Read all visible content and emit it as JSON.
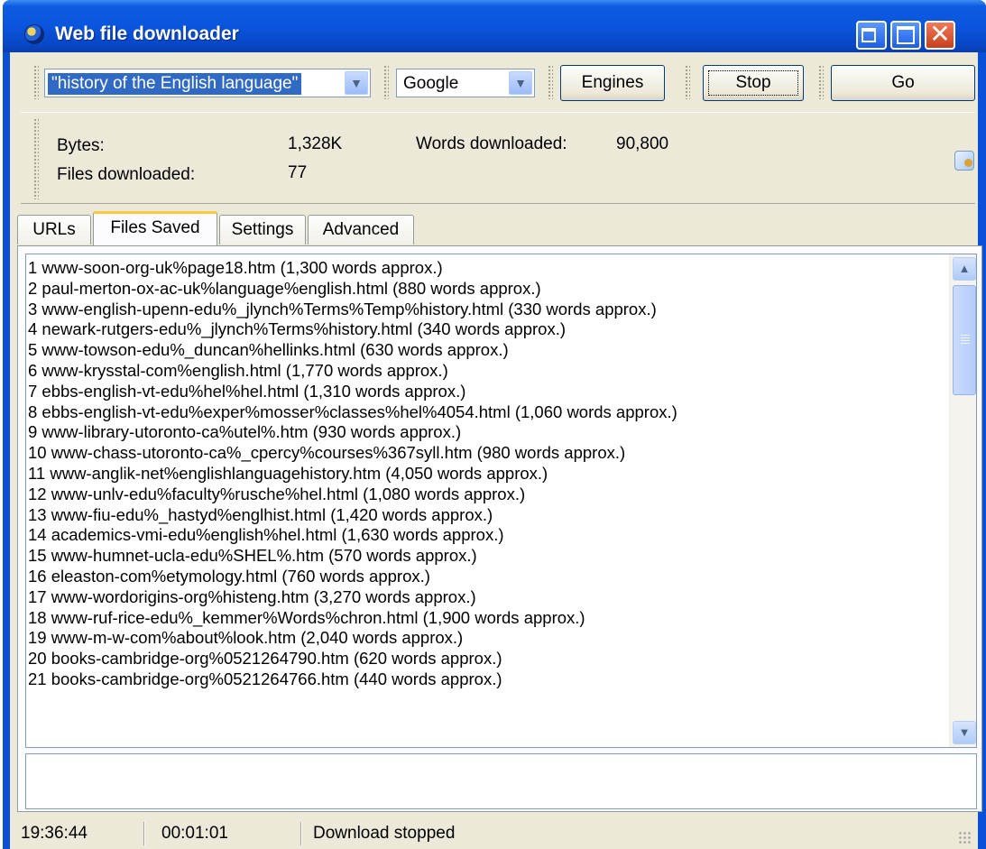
{
  "window": {
    "title": "Web file downloader"
  },
  "toolbar": {
    "query_value": "\"history of the English language\"",
    "engine_value": "Google",
    "engines_label": "Engines",
    "stop_label": "Stop",
    "go_label": "Go"
  },
  "stats": {
    "bytes_label": "Bytes:",
    "bytes_value": "1,328K",
    "words_label": "Words downloaded:",
    "words_value": "90,800",
    "files_label": "Files downloaded:",
    "files_value": "77"
  },
  "tabs": [
    {
      "label": "URLs"
    },
    {
      "label": "Files Saved"
    },
    {
      "label": "Settings"
    },
    {
      "label": "Advanced"
    }
  ],
  "files": [
    "1 www-soon-org-uk%page18.htm (1,300 words approx.)",
    "2 paul-merton-ox-ac-uk%language%english.html (880 words approx.)",
    "3 www-english-upenn-edu%_jlynch%Terms%Temp%history.html (330 words approx.)",
    "4 newark-rutgers-edu%_jlynch%Terms%history.html (340 words approx.)",
    "5 www-towson-edu%_duncan%hellinks.html (630 words approx.)",
    "6 www-krysstal-com%english.html (1,770 words approx.)",
    "7 ebbs-english-vt-edu%hel%hel.html (1,310 words approx.)",
    "8 ebbs-english-vt-edu%exper%mosser%classes%hel%4054.html (1,060 words approx.)",
    "9 www-library-utoronto-ca%utel%.htm (930 words approx.)",
    "10 www-chass-utoronto-ca%_cpercy%courses%367syll.htm (980 words approx.)",
    "11 www-anglik-net%englishlanguagehistory.htm (4,050 words approx.)",
    "12 www-unlv-edu%faculty%rusche%hel.html (1,080 words approx.)",
    "13 www-fiu-edu%_hastyd%englhist.html (1,420 words approx.)",
    "14 academics-vmi-edu%english%hel.html (1,630 words approx.)",
    "15 www-humnet-ucla-edu%SHEL%.htm (570 words approx.)",
    "16 eleaston-com%etymology.html (760 words approx.)",
    "17 www-wordorigins-org%histeng.htm (3,270 words approx.)",
    "18 www-ruf-rice-edu%_kemmer%Words%chron.html (1,900 words approx.)",
    "19 www-m-w-com%about%look.htm (2,040 words approx.)",
    "20 books-cambridge-org%0521264790.htm (620 words approx.)",
    "21 books-cambridge-org%0521264766.htm (440 words approx.)"
  ],
  "status": {
    "time": "19:36:44",
    "elapsed": "00:01:01",
    "message": "Download stopped"
  },
  "colors": {
    "title_bar": "#0a55dd",
    "selection": "#316ac5",
    "active_tab_accent": "#ffc83c"
  },
  "icons": [
    "app-globe-icon",
    "minimize-icon",
    "maximize-icon",
    "close-icon",
    "dropdown-arrow-icon",
    "search-page-icon",
    "scroll-up-icon",
    "scroll-down-icon"
  ]
}
